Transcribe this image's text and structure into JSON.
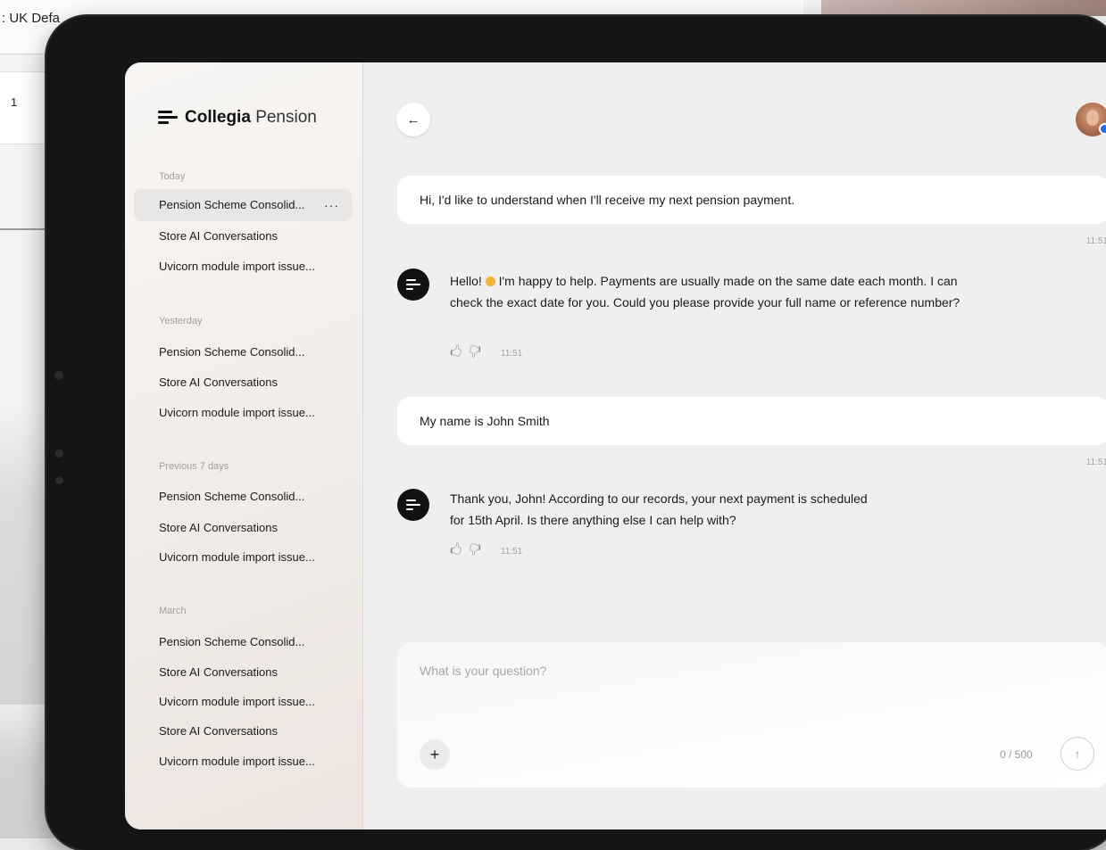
{
  "background": {
    "window_label": ": UK Defa",
    "row_number": "1"
  },
  "app": {
    "logo_bold": "Collegia",
    "logo_light": "Pension"
  },
  "sidebar": {
    "groups": [
      {
        "label": "Today",
        "items": [
          "Pension Scheme Consolid...",
          "Store AI Conversations",
          "Uvicorn module import issue..."
        ]
      },
      {
        "label": "Yesterday",
        "items": [
          "Pension Scheme Consolid...",
          "Store AI Conversations",
          "Uvicorn module import issue..."
        ]
      },
      {
        "label": "Previous 7 days",
        "items": [
          "Pension Scheme Consolid...",
          "Store AI Conversations",
          "Uvicorn module import issue..."
        ]
      },
      {
        "label": "March",
        "items": [
          "Pension Scheme Consolid...",
          "Store AI Conversations",
          "Uvicorn module import issue...",
          "Store AI Conversations",
          "Uvicorn module import issue..."
        ]
      }
    ],
    "active_more": "···"
  },
  "chat": {
    "back_icon": "←",
    "messages": [
      {
        "role": "user",
        "text": "Hi, I'd like to understand when I'll receive my next pension payment.",
        "time": "11:51"
      },
      {
        "role": "bot",
        "text_before_emoji": "Hello! ",
        "text_after_emoji": " I'm happy to help. Payments are usually made on the same date each month. I can check the exact date for you. Could you please provide your full name or reference number?",
        "time": "11:51"
      },
      {
        "role": "user",
        "text": "My name is John Smith",
        "time": "11:51"
      },
      {
        "role": "bot",
        "text": "Thank you, John! According to our records, your next payment is scheduled for 15th April. Is there anything else I can help with?",
        "time": "11:51"
      }
    ],
    "thumbs_up_icon": "👍",
    "thumbs_down_icon": "👎"
  },
  "composer": {
    "placeholder": "What is your question?",
    "plus": "+",
    "counter": "0 / 500",
    "send_icon": "↑"
  },
  "colors": {
    "online": "#1f6bff",
    "bot_avatar": "#111111"
  }
}
